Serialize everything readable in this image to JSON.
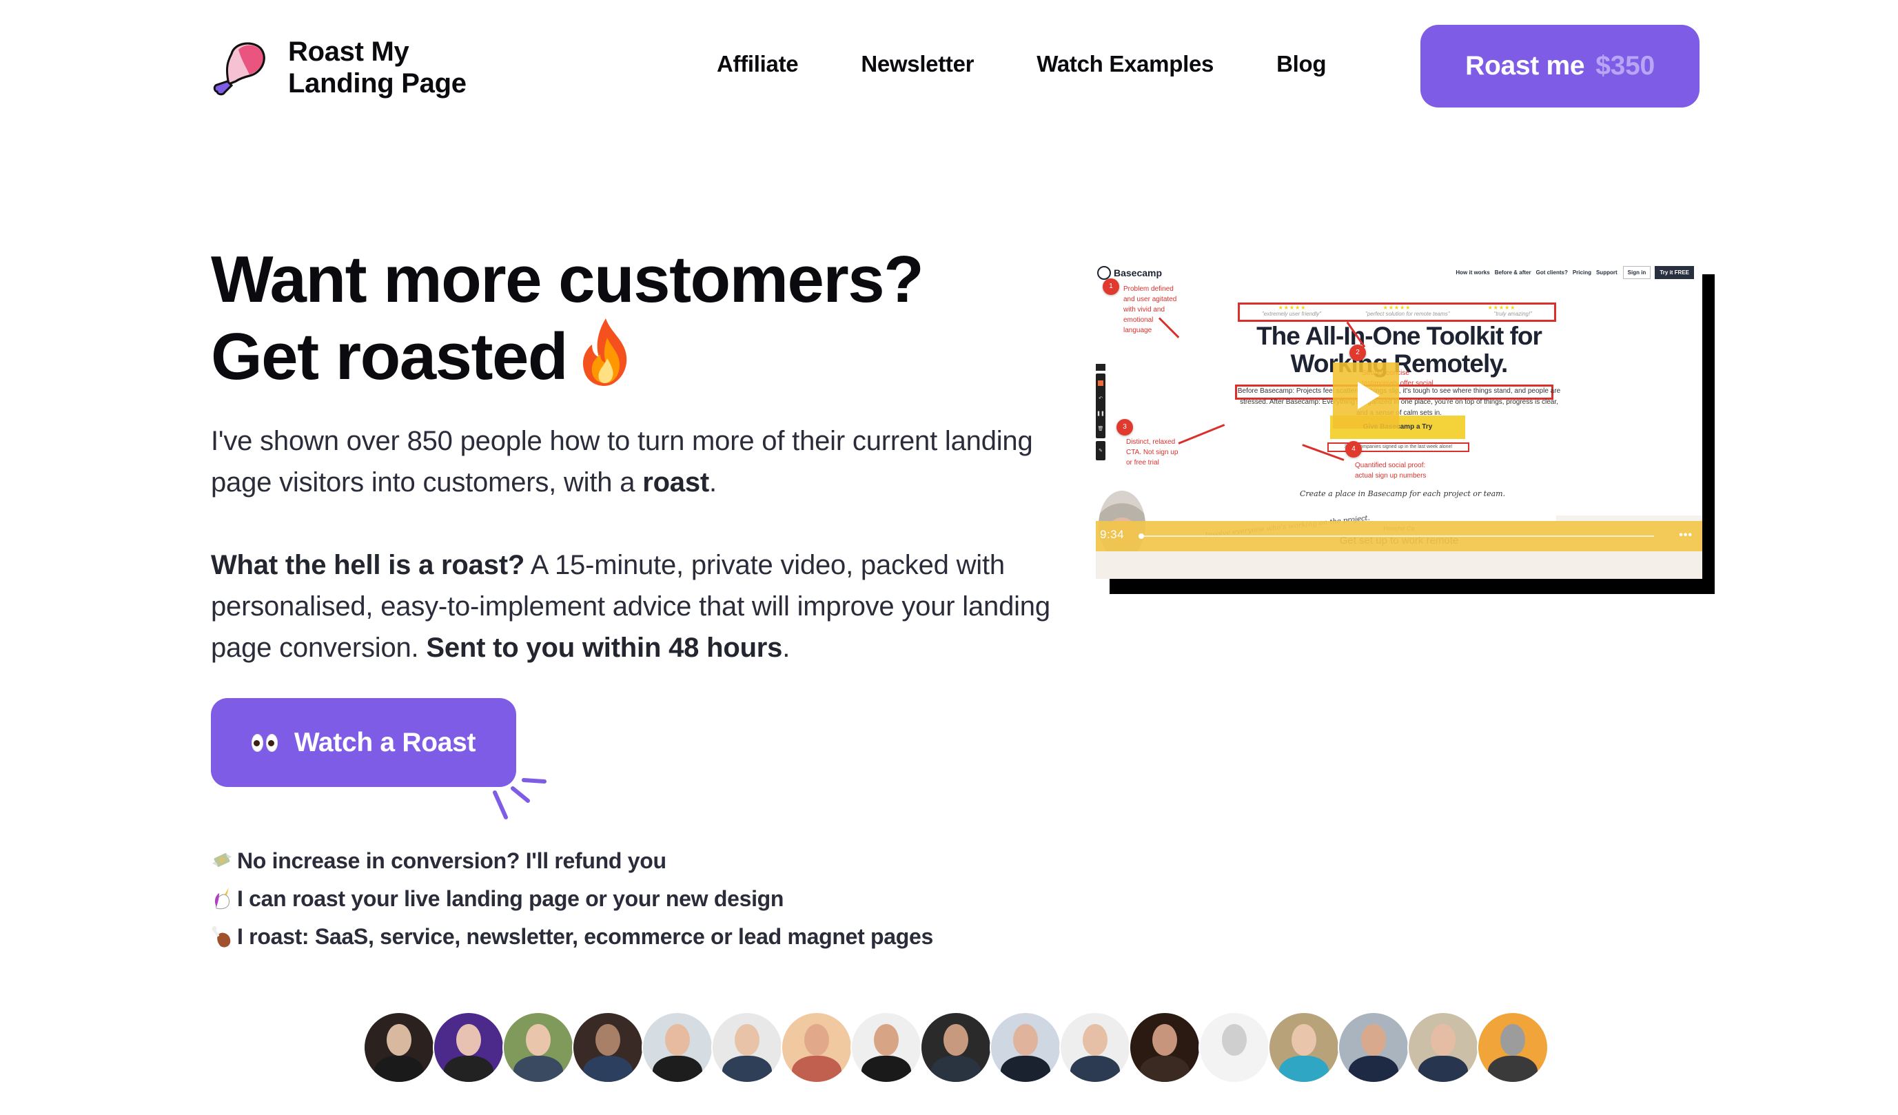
{
  "header": {
    "logo": {
      "line1": "Roast My",
      "line2": "Landing Page",
      "icon": "chicken-drumstick-icon"
    },
    "nav": [
      {
        "label": "Affiliate"
      },
      {
        "label": "Newsletter"
      },
      {
        "label": "Watch Examples"
      },
      {
        "label": "Blog"
      }
    ],
    "cta": {
      "label": "Roast me",
      "price": "$350"
    }
  },
  "hero": {
    "headline_line1": "Want more customers?",
    "headline_line2": "Get roasted",
    "headline_emoji": "fire-icon",
    "para1": {
      "text": "I've shown over 850 people how to turn more of their current landing page visitors into customers, with a ",
      "bold": "roast",
      "end": "."
    },
    "para2": {
      "bold_intro": "What the hell is a roast?",
      "text": " A 15-minute, private video, packed with personalised, easy-to-implement advice that will improve your landing page conversion. ",
      "bold_end": "Sent to you within 48 hours",
      "end": "."
    },
    "watch_button": {
      "label": "Watch a Roast",
      "icon": "eyes-icon"
    },
    "bullets": [
      {
        "icon": "money-with-wings-icon",
        "text": "No increase in conversion? I'll refund you"
      },
      {
        "icon": "unicorn-icon",
        "text": "I can roast your live landing page or your new design"
      },
      {
        "icon": "poultry-leg-icon",
        "text": "I roast: SaaS, service, newsletter, ecommerce or lead magnet pages"
      }
    ]
  },
  "video": {
    "site_logo": "Basecamp",
    "site_nav": [
      "How it works",
      "Before & after",
      "Got clients?",
      "Pricing",
      "Support"
    ],
    "site_sign_in": "Sign in",
    "site_try": "Try it FREE",
    "reviews": [
      "\"extremely user friendly\"",
      "\"perfect solution for remote teams\"",
      "\"truly amazing!\""
    ],
    "stars": "★★★★★",
    "site_title": "The All-In-One Toolkit for Working Remotely.",
    "site_before": "Before Basecamp: Projects feel scattered, things slip, it's tough to see where things stand, and people are stressed. After Basecamp: Everything's organized in one place, you're on top of things, progress is clear, and a sense of calm sets in.",
    "site_cta": "Give Basecamp a Try",
    "site_signed": "3,743 companies signed up in the last week alone!",
    "site_handwrite": "Create a place in Basecamp for each project or team.",
    "site_company": "Honcho Co",
    "site_card_title": "Get set up to work remote",
    "site_involve": "Involve everyone who's working on the project.",
    "annotations": [
      {
        "num": "1",
        "text": "Problem defined and user agitated with vivid and emotional language"
      },
      {
        "num": "2",
        "text": "Strong, concise testimonials offer social proof."
      },
      {
        "num": "3",
        "text": "Distinct, relaxed CTA. Not sign up or free trial"
      },
      {
        "num": "4",
        "text": "Quantified social proof: actual sign up numbers"
      }
    ],
    "time": "9:34",
    "progress": 0.0,
    "more_label": "•••"
  },
  "avatars": {
    "count": 17,
    "palette": [
      [
        "#2b2220",
        "#d9b8a0",
        "#1a1a1a"
      ],
      [
        "#4b2a8c",
        "#e7c2b2",
        "#222"
      ],
      [
        "#7f9a5a",
        "#e9c5ab",
        "#3a4a60"
      ],
      [
        "#3a2a26",
        "#a88068",
        "#2c3f5e"
      ],
      [
        "#d5dde2",
        "#e6bba0",
        "#1d1d1d"
      ],
      [
        "#e8e8e8",
        "#e9c3a8",
        "#2e3f57"
      ],
      [
        "#f1c9a0",
        "#e2a88a",
        "#c1604e"
      ],
      [
        "#efefef",
        "#d8a486",
        "#1a1a1a"
      ],
      [
        "#2a2a2a",
        "#c79a80",
        "#2a3440"
      ],
      [
        "#cfd8e2",
        "#e0b49c",
        "#1a2230"
      ],
      [
        "#eeeeee",
        "#e6c0a6",
        "#2d3b52"
      ],
      [
        "#2b1a12",
        "#c7947c",
        "#3a2a22"
      ],
      [
        "#f3f3f3",
        "#cfcfcf",
        "#f3f3f3"
      ],
      [
        "#b8a27a",
        "#e9c5ac",
        "#2ea6c4"
      ],
      [
        "#aab4bf",
        "#d9a98e",
        "#1e2a44"
      ],
      [
        "#cbbfa8",
        "#e5bda4",
        "#27364e"
      ],
      [
        "#f0a43a",
        "#9c9c9c",
        "#3a3a3a"
      ]
    ]
  },
  "colors": {
    "brand_purple": "#7e5ce6",
    "price_lavender": "#b9a5f6",
    "text_dark": "#0b0b0f",
    "text_body": "#2a2c3a",
    "annotation_red": "#d9302c",
    "video_yellow": "#f2c54b"
  }
}
